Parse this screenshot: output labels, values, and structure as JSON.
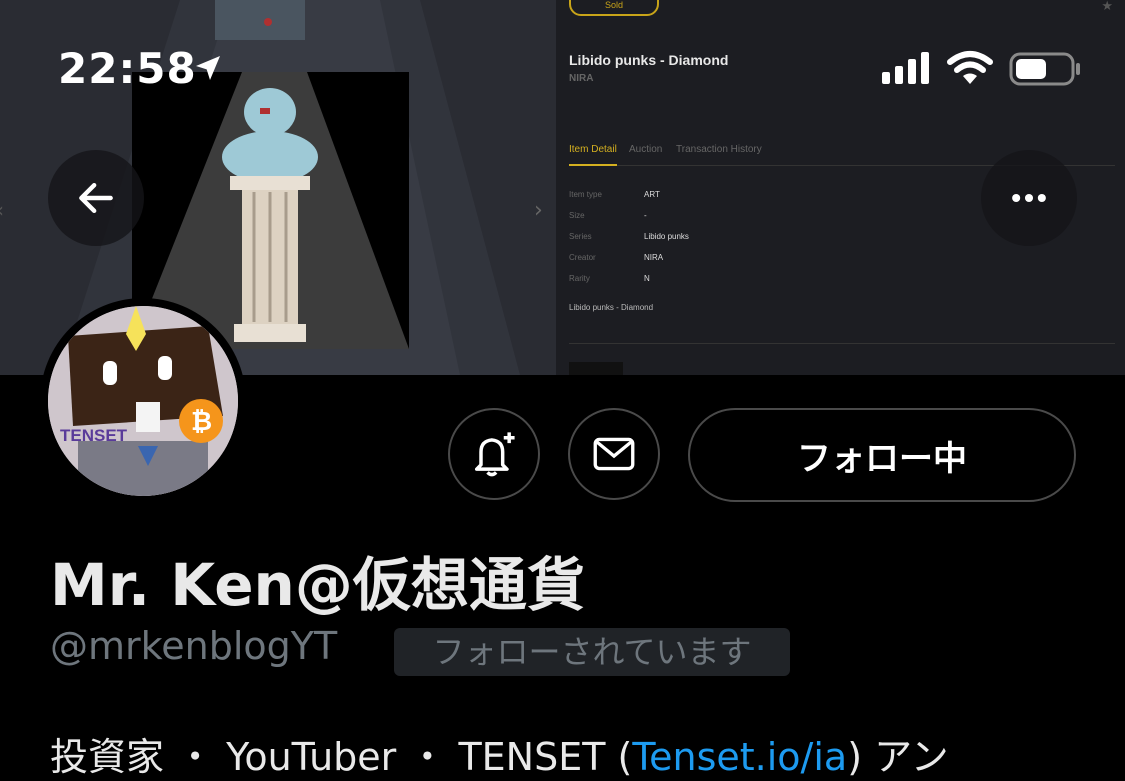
{
  "status_bar": {
    "time": "22:58"
  },
  "banner": {
    "sold_label": "Sold",
    "nft_title": "Libido punks - Diamond",
    "creator": "NIRA",
    "tabs": [
      {
        "label": "Item Detail",
        "active": true
      },
      {
        "label": "Auction",
        "active": false
      },
      {
        "label": "Transaction History",
        "active": false
      }
    ],
    "details": [
      {
        "label": "Item type",
        "value": "ART"
      },
      {
        "label": "Size",
        "value": "-"
      },
      {
        "label": "Series",
        "value": "Libido punks"
      },
      {
        "label": "Creator",
        "value": "NIRA"
      },
      {
        "label": "Rarity",
        "value": "N"
      }
    ],
    "description": "Libido punks - Diamond",
    "colors": {
      "accent": "#d4b020"
    }
  },
  "nav": {
    "back_icon": "arrow-left-icon",
    "more_icon": "more-horizontal-icon"
  },
  "actions": {
    "notify_icon": "bell-plus-icon",
    "message_icon": "envelope-icon",
    "follow_label": "フォロー中"
  },
  "profile": {
    "avatar_text": "TENSET",
    "display_name": "Mr. Ken@仮想通貨",
    "handle": "@mrkenblogYT",
    "follows_you": "フォローされています",
    "bio_prefix": "投資家 ・ YouTuber ・ TENSET (",
    "bio_link": "Tenset.io/ia",
    "bio_suffix": ") アン"
  },
  "colors": {
    "link": "#1d9bf0",
    "muted": "#6e767d",
    "background": "#000000"
  }
}
